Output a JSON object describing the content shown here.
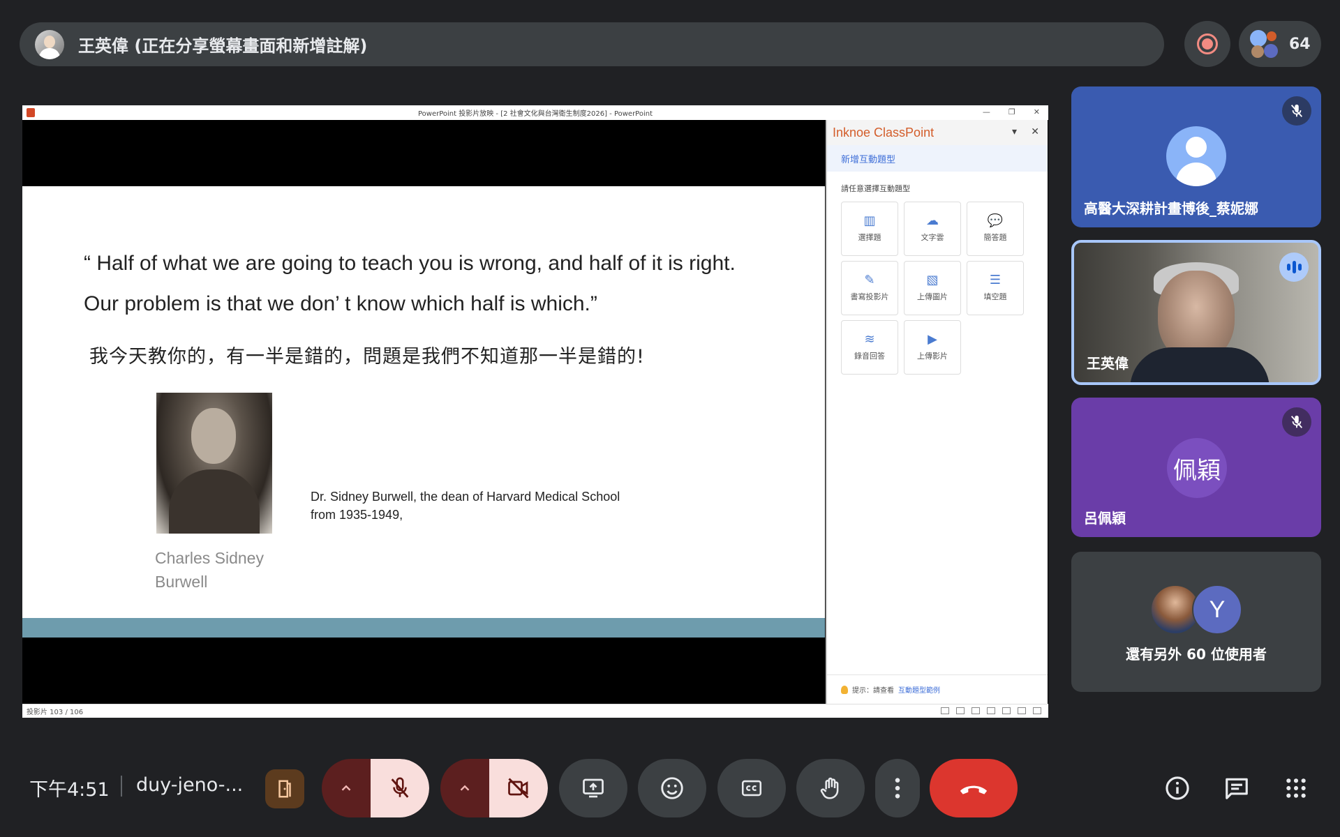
{
  "presenter_bar": {
    "label": "王英偉 (正在分享螢幕畫面和新增註解)"
  },
  "participant_count": "64",
  "ppt": {
    "window_title": "PowerPoint 投影片放映 - [2 社會文化與台灣衛生制度2026] - PowerPoint",
    "status_left": "投影片 103 / 106"
  },
  "slide": {
    "quote_en": "“ Half of what we are going to teach you is wrong, and half of it is right. Our problem is that we don’ t know which half is which.”",
    "quote_zh": "我今天教你的，有一半是錯的，問題是我們不知道那一半是錯的!",
    "portrait_caption": "Charles Sidney Burwell",
    "dean_text": "Dr. Sidney Burwell, the dean of Harvard Medical School from 1935-1949,"
  },
  "classpoint": {
    "title": "Inknoe ClassPoint",
    "subtitle": "新增互動題型",
    "prompt": "請任意選擇互動題型",
    "tiles": [
      {
        "label": "選擇題",
        "icon": "bar-chart-icon"
      },
      {
        "label": "文字雲",
        "icon": "cloud-icon"
      },
      {
        "label": "簡答題",
        "icon": "speech-bubble-icon"
      },
      {
        "label": "書寫投影片",
        "icon": "draw-slide-icon"
      },
      {
        "label": "上傳圖片",
        "icon": "upload-image-icon"
      },
      {
        "label": "填空題",
        "icon": "fill-blank-icon"
      },
      {
        "label": "錄音回答",
        "icon": "audio-wave-icon"
      },
      {
        "label": "上傳影片",
        "icon": "upload-video-icon"
      }
    ],
    "tip_prefix": "提示：請查看",
    "tip_link": "互動題型範例"
  },
  "participants": [
    {
      "name": "高醫大深耕計畫博後_蔡妮娜",
      "muted": true
    },
    {
      "name": "王英偉",
      "speaking": true
    },
    {
      "name": "呂佩穎",
      "initials": "佩穎",
      "muted": true
    }
  ],
  "others": {
    "avatar_letter": "Y",
    "label": "還有另外 60 位使用者"
  },
  "bottom": {
    "time": "下午4:51",
    "meeting_code": "duy-jeno-..."
  },
  "colors": {
    "background": "#202124",
    "end_call": "#dc362e",
    "classpoint_brand": "#d35d2a",
    "active_border": "#a8c7fa"
  }
}
